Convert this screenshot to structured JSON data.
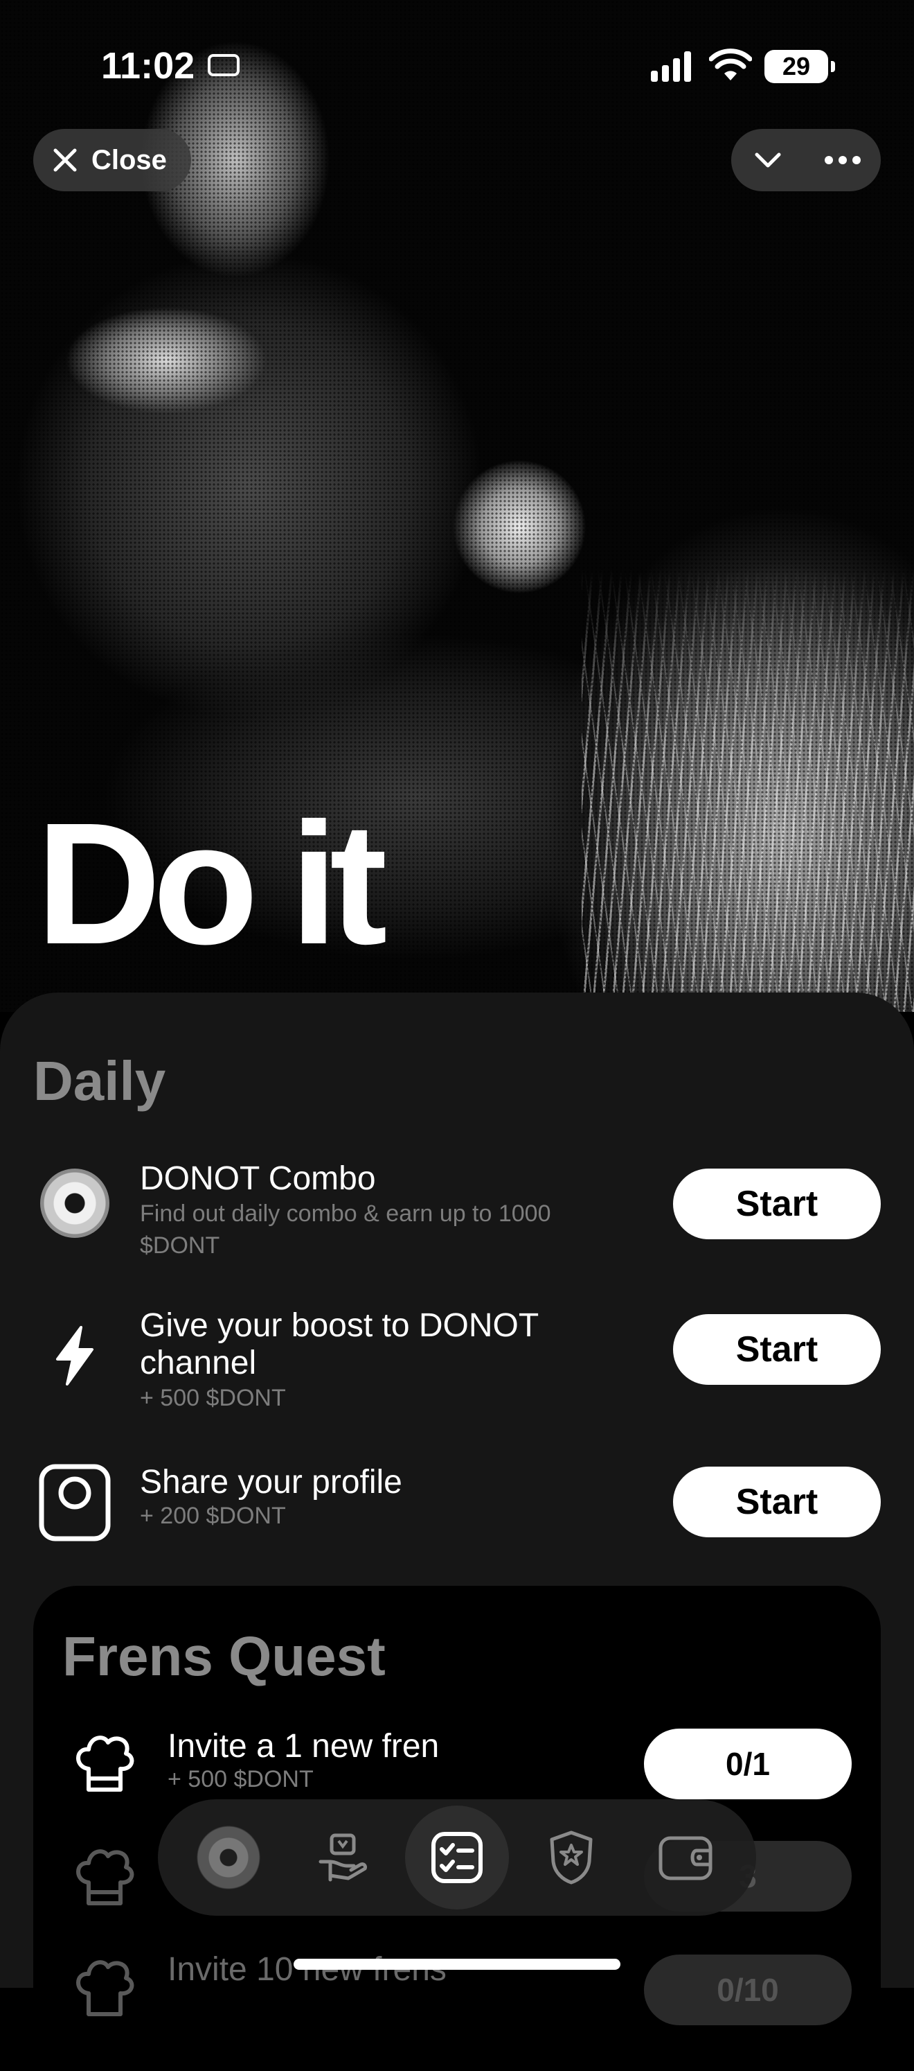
{
  "status_bar": {
    "time": "11:02",
    "battery": "29"
  },
  "header": {
    "close_label": "Close"
  },
  "hero": {
    "title": "Do it"
  },
  "daily": {
    "title": "Daily",
    "tasks": [
      {
        "title": "DONOT Combo",
        "subtitle": "Find out daily combo & earn up to 1000 $DONT",
        "button": "Start",
        "icon": "donut-icon"
      },
      {
        "title": "Give your boost to DONOT channel",
        "subtitle": "+ 500 $DONT",
        "button": "Start",
        "icon": "lightning-icon"
      },
      {
        "title": "Share your profile",
        "subtitle": "+ 200 $DONT",
        "button": "Start",
        "icon": "instagram-icon"
      }
    ]
  },
  "frens_quest": {
    "title": "Frens Quest",
    "quests": [
      {
        "title": "Invite a 1 new fren",
        "subtitle": "+ 500 $DONT",
        "progress": "0/1",
        "icon": "chef-hat-icon"
      },
      {
        "title": "",
        "subtitle": "",
        "progress": "3",
        "icon": "chef-hat-icon"
      },
      {
        "title": "Invite 10 new frens",
        "subtitle": "",
        "progress": "0/10",
        "icon": "chef-hat-icon"
      }
    ]
  },
  "tab_bar": {
    "tabs": [
      {
        "name": "donut-tab",
        "icon": "donut-icon",
        "active": false
      },
      {
        "name": "rewards-tab",
        "icon": "gift-hand-icon",
        "active": false
      },
      {
        "name": "tasks-tab",
        "icon": "checklist-icon",
        "active": true
      },
      {
        "name": "badge-tab",
        "icon": "police-badge-icon",
        "active": false
      },
      {
        "name": "wallet-tab",
        "icon": "wallet-icon",
        "active": false
      }
    ]
  },
  "colors": {
    "background": "#000000",
    "sheet": "#161616",
    "muted_text": "#7d7d7d",
    "title_gray": "#8a8a8a",
    "button_bg": "#ffffff"
  }
}
